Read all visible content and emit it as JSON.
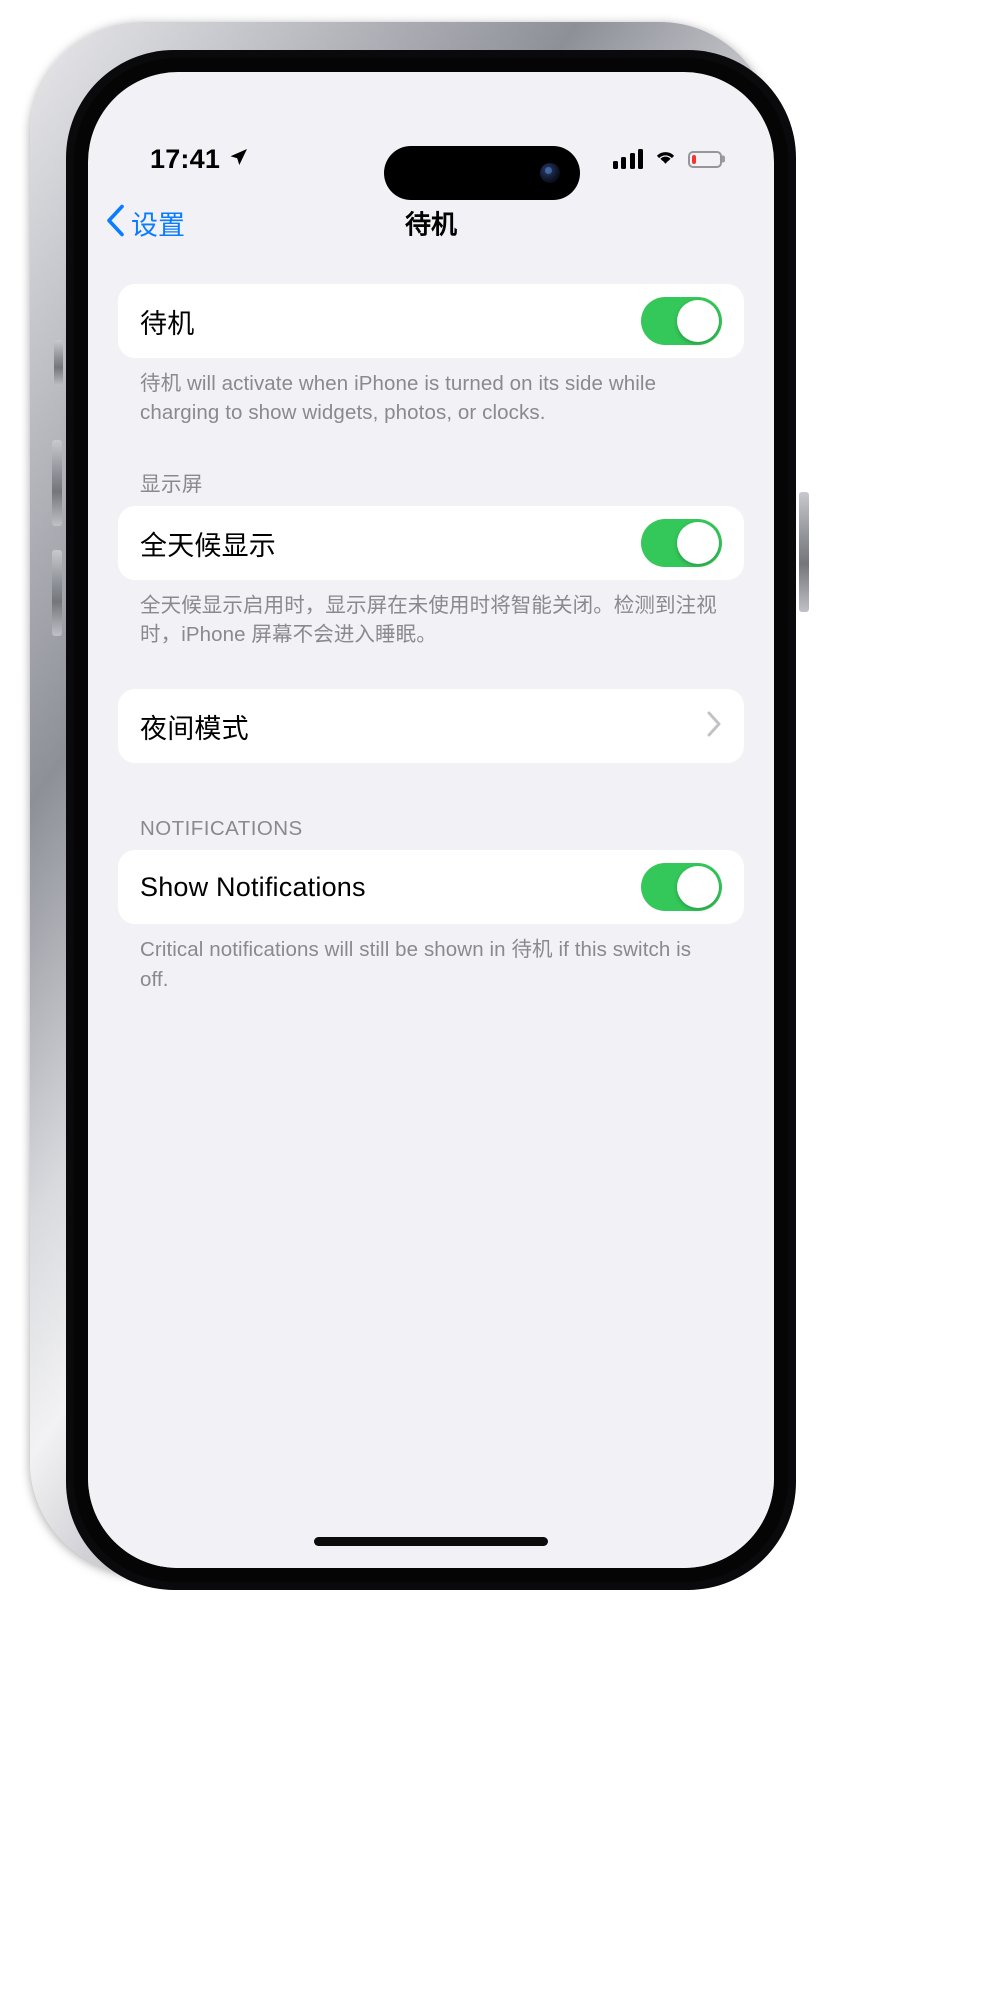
{
  "status_bar": {
    "time": "17:41",
    "location_icon": "location-arrow-icon",
    "cellular_icon": "cellular-bars-icon",
    "cellular_bars": 4,
    "wifi_icon": "wifi-icon",
    "battery_icon": "battery-icon",
    "battery_level_percent": 15,
    "battery_color": "#f6352e"
  },
  "nav": {
    "back_label": "设置",
    "back_icon": "chevron-left-icon",
    "title": "待机",
    "accent_color": "#0a7cff"
  },
  "sections": [
    {
      "header": "",
      "rows": [
        {
          "label": "待机",
          "type": "toggle",
          "value": "on"
        }
      ],
      "footer": "待机 will activate when iPhone is turned on its side while charging to show widgets, photos, or clocks."
    },
    {
      "header": "显示屏",
      "rows": [
        {
          "label": "全天候显示",
          "type": "toggle",
          "value": "on"
        }
      ],
      "footer": "全天候显示启用时，显示屏在未使用时将智能关闭。检测到注视时，iPhone 屏幕不会进入睡眠。"
    },
    {
      "header": "",
      "rows": [
        {
          "label": "夜间模式",
          "type": "disclosure",
          "value": ""
        }
      ],
      "footer": ""
    },
    {
      "header": "NOTIFICATIONS",
      "rows": [
        {
          "label": "Show Notifications",
          "type": "toggle",
          "value": "on"
        }
      ],
      "footer": "Critical notifications will still be shown in 待机 if this switch is off."
    }
  ],
  "colors": {
    "toggle_on": "#34c759",
    "background": "#f2f1f6",
    "card": "#ffffff",
    "secondary_text": "#8a8a8e"
  },
  "home_indicator": "home-indicator"
}
